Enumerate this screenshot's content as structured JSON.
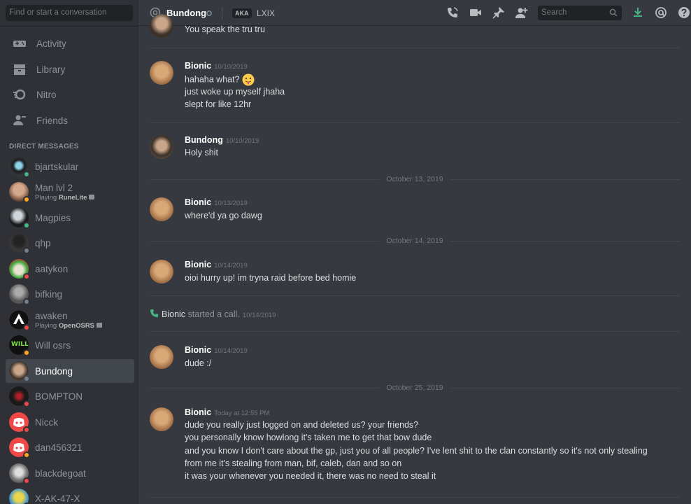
{
  "sidebar": {
    "search_placeholder": "Find or start a conversation",
    "nav": [
      {
        "label": "Activity",
        "icon": "gamepad-icon"
      },
      {
        "label": "Library",
        "icon": "library-icon"
      },
      {
        "label": "Nitro",
        "icon": "nitro-icon"
      },
      {
        "label": "Friends",
        "icon": "friends-icon"
      }
    ],
    "dm_header": "DIRECT MESSAGES",
    "dms": [
      {
        "name": "bjartskular",
        "status": "online",
        "activity_prefix": "",
        "activity_game": ""
      },
      {
        "name": "Man lvl 2",
        "status": "idle",
        "activity_prefix": "Playing",
        "activity_game": "RuneLite"
      },
      {
        "name": "Magpies",
        "status": "online",
        "activity_prefix": "",
        "activity_game": ""
      },
      {
        "name": "qhp",
        "status": "offline",
        "activity_prefix": "",
        "activity_game": ""
      },
      {
        "name": "aatykon",
        "status": "dnd",
        "activity_prefix": "",
        "activity_game": ""
      },
      {
        "name": "bifking",
        "status": "offline",
        "activity_prefix": "",
        "activity_game": ""
      },
      {
        "name": "awaken",
        "status": "dnd",
        "activity_prefix": "Playing",
        "activity_game": "OpenOSRS"
      },
      {
        "name": "Will osrs",
        "status": "idle",
        "activity_prefix": "",
        "activity_game": ""
      },
      {
        "name": "Bundong",
        "status": "offline",
        "activity_prefix": "",
        "activity_game": ""
      },
      {
        "name": "BOMPTON",
        "status": "dnd",
        "activity_prefix": "",
        "activity_game": ""
      },
      {
        "name": "Nicck",
        "status": "dnd",
        "activity_prefix": "",
        "activity_game": ""
      },
      {
        "name": "dan456321",
        "status": "idle",
        "activity_prefix": "",
        "activity_game": ""
      },
      {
        "name": "blackdegoat",
        "status": "dnd",
        "activity_prefix": "",
        "activity_game": ""
      },
      {
        "name": "X-AK-47-X",
        "status": "offline",
        "activity_prefix": "",
        "activity_game": ""
      }
    ]
  },
  "header": {
    "channel_name": "Bundong",
    "aka_label": "AKA",
    "aka_name": "LXIX",
    "search_placeholder": "Search"
  },
  "messages": {
    "top_fragment": "You speak the tru tru",
    "group1": {
      "author": "Bionic",
      "time": "10/10/2019",
      "line1": "hahaha what?",
      "line2": "just woke up myself jhaha",
      "line3": "slept for like 12hr"
    },
    "group2": {
      "author": "Bundong",
      "time": "10/10/2019",
      "line1": "Holy shit"
    },
    "date1": "October 13, 2019",
    "group3": {
      "author": "Bionic",
      "time": "10/13/2019",
      "line1": "where'd ya go dawg"
    },
    "date2": "October 14, 2019",
    "group4": {
      "author": "Bionic",
      "time": "10/14/2019",
      "line1": "oioi hurry up! im tryna raid before bed homie"
    },
    "call": {
      "author": "Bionic",
      "text": "started a call.",
      "time": "10/14/2019"
    },
    "group5": {
      "author": "Bionic",
      "time": "10/14/2019",
      "line1": "dude :/"
    },
    "date3": "October 25, 2019",
    "group6": {
      "author": "Bionic",
      "time": "Today at 12:55 PM",
      "line1": "dude you really just logged on and deleted us? your friends?",
      "line2": "you personally know howlong it's taken me to get that bow dude",
      "line3": "and you know I don't care about the gp, just you of all people? I've lent shit to the clan constantly so it's not only stealing",
      "line4": "from me it's stealing from man, bif, caleb, dan and so on",
      "line5": "it was your whenever you needed it, there was no need to steal it"
    }
  },
  "colors": {
    "sidebar_bg": "#2f3136",
    "chat_bg": "#36393f",
    "accent_green": "#43b581",
    "accent_red": "#f04747",
    "accent_idle": "#faa61a"
  }
}
